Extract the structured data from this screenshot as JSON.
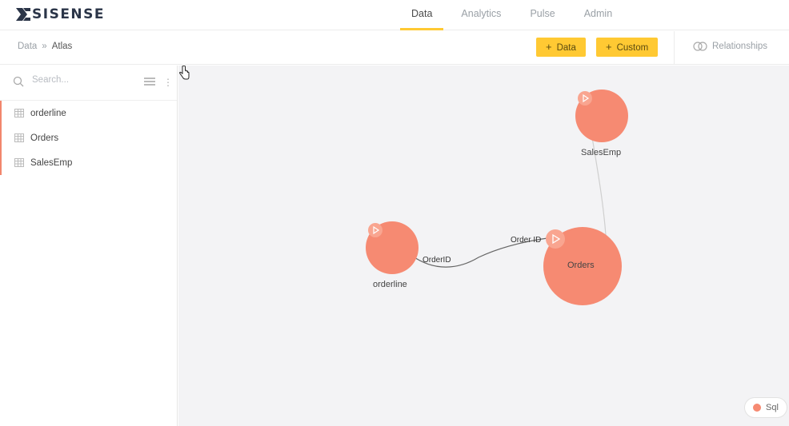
{
  "app": {
    "logo_text": "SISENSE"
  },
  "nav": {
    "tabs": [
      {
        "label": "Data"
      },
      {
        "label": "Analytics"
      },
      {
        "label": "Pulse"
      },
      {
        "label": "Admin"
      }
    ],
    "active": "Data"
  },
  "breadcrumb": {
    "root": "Data",
    "separator": "»",
    "current": "Atlas"
  },
  "toolbar": {
    "add_data_label": "Data",
    "add_custom_label": "Custom",
    "relationships_label": "Relationships"
  },
  "sidebar": {
    "search_placeholder": "Search...",
    "tables": [
      {
        "name": "orderline"
      },
      {
        "name": "Orders"
      },
      {
        "name": "SalesEmp"
      }
    ]
  },
  "canvas": {
    "nodes": [
      {
        "name": "SalesEmp"
      },
      {
        "name": "orderline"
      },
      {
        "name": "Orders"
      }
    ],
    "edges": [
      {
        "from_label": "OrderID",
        "to_label": "Order ID"
      }
    ],
    "legend": {
      "label": "Sql",
      "color": "#f68a72"
    }
  },
  "colors": {
    "accent": "#ffc933",
    "node": "#f68a72",
    "canvas_bg": "#f3f3f5"
  }
}
